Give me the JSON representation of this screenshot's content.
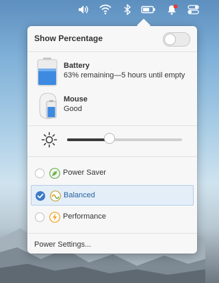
{
  "topbar": {
    "icons": [
      "volume-icon",
      "wifi-icon",
      "bluetooth-icon",
      "battery-icon",
      "notifications-icon",
      "settings-toggle-icon"
    ],
    "notification_dot_color": "#e53935"
  },
  "power_menu": {
    "show_percentage_label": "Show Percentage",
    "show_percentage_enabled": false,
    "devices": [
      {
        "name": "Battery",
        "status": "63% remaining—5 hours until empty",
        "icon": "battery-level-icon",
        "level_percent": 63
      },
      {
        "name": "Mouse",
        "status": "Good",
        "icon": "mouse-battery-icon"
      }
    ],
    "brightness_icon": "brightness-icon",
    "brightness_level": 0.37,
    "power_modes": [
      {
        "label": "Power Saver",
        "icon": "leaf-icon",
        "selected": false
      },
      {
        "label": "Balanced",
        "icon": "balance-icon",
        "selected": true
      },
      {
        "label": "Performance",
        "icon": "lightning-icon",
        "selected": false
      }
    ],
    "settings_link": "Power Settings..."
  },
  "colors": {
    "accent": "#3d7bc8",
    "battery_fill": "#3d8ae0",
    "leaf": "#6ab04c",
    "performance": "#f0a020"
  }
}
